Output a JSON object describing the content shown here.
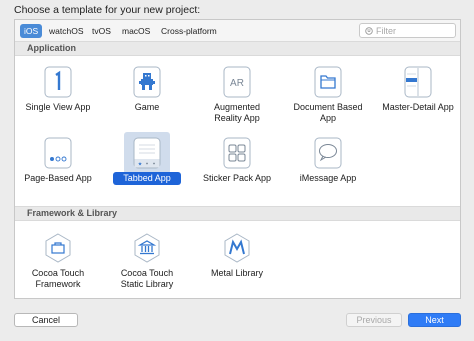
{
  "dialog": {
    "title": "Choose a template for your new project:"
  },
  "platform_tabs": [
    "iOS",
    "watchOS",
    "tvOS",
    "macOS",
    "Cross-platform"
  ],
  "selected_tab": "iOS",
  "filter": {
    "placeholder": "Filter",
    "icon": "filter-icon"
  },
  "sections": {
    "application": "Application",
    "framework": "Framework & Library"
  },
  "templates": {
    "single_view": {
      "label": "Single View App",
      "icon": "single-view-app-icon"
    },
    "game": {
      "label": "Game",
      "icon": "game-icon"
    },
    "augmented_reality": {
      "label": "Augmented\nReality App",
      "icon": "augmented-reality-icon"
    },
    "document_based": {
      "label": "Document Based\nApp",
      "icon": "document-based-app-icon"
    },
    "master_detail": {
      "label": "Master-Detail App",
      "icon": "master-detail-app-icon"
    },
    "page_based": {
      "label": "Page-Based App",
      "icon": "page-based-app-icon"
    },
    "tabbed": {
      "label": "Tabbed App",
      "icon": "tabbed-app-icon",
      "selected": true
    },
    "sticker_pack": {
      "label": "Sticker Pack App",
      "icon": "sticker-pack-app-icon"
    },
    "imessage": {
      "label": "iMessage App",
      "icon": "imessage-app-icon"
    },
    "cocoa_framework": {
      "label": "Cocoa Touch\nFramework",
      "icon": "cocoa-touch-framework-icon"
    },
    "cocoa_static": {
      "label": "Cocoa Touch\nStatic Library",
      "icon": "cocoa-touch-static-library-icon"
    },
    "metal_library": {
      "label": "Metal Library",
      "icon": "metal-library-icon"
    }
  },
  "buttons": {
    "cancel": "Cancel",
    "previous": "Previous",
    "next": "Next"
  },
  "colors": {
    "accent": "#2f7cf6",
    "selection": "#1e64d8",
    "icon_blue": "#3478d0"
  }
}
